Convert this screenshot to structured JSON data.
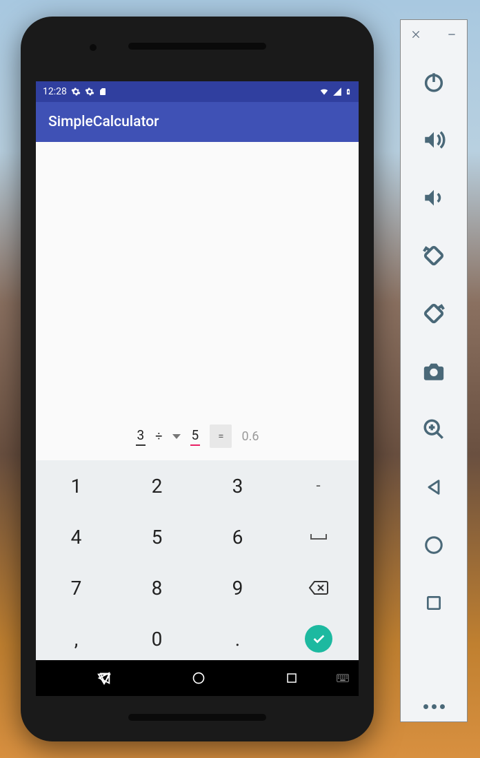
{
  "status": {
    "time": "12:28",
    "icons_left": [
      "gear-icon",
      "gear-icon",
      "sd-card-icon"
    ],
    "icons_right": [
      "wifi-icon",
      "signal-icon",
      "battery-icon"
    ]
  },
  "app": {
    "title": "SimpleCalculator"
  },
  "calc": {
    "operand1": "3",
    "operator": "÷",
    "operand2": "5",
    "equals_label": "=",
    "result": "0.6"
  },
  "keyboard": {
    "rows": [
      [
        "1",
        "2",
        "3",
        "-"
      ],
      [
        "4",
        "5",
        "6",
        "␣"
      ],
      [
        "7",
        "8",
        "9",
        "⌫"
      ],
      [
        ",",
        "0",
        ".",
        "✓"
      ]
    ]
  },
  "toolbar": {
    "buttons": [
      "power-icon",
      "volume-up-icon",
      "volume-down-icon",
      "rotate-left-icon",
      "rotate-right-icon",
      "camera-icon",
      "zoom-icon",
      "back-icon",
      "home-icon",
      "overview-icon"
    ]
  }
}
